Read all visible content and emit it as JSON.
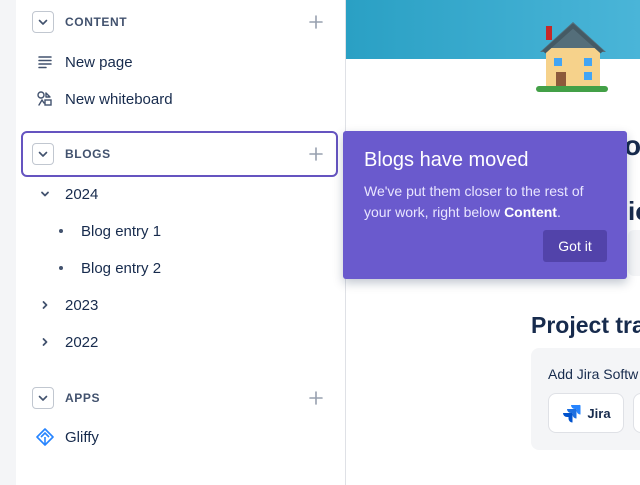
{
  "sidebar": {
    "content_section": {
      "title": "CONTENT",
      "items": [
        {
          "label": "New page",
          "icon": "page-lines-icon"
        },
        {
          "label": "New whiteboard",
          "icon": "whiteboard-shapes-icon"
        }
      ]
    },
    "blogs_section": {
      "title": "BLOGS",
      "years": [
        {
          "label": "2024",
          "expanded": true,
          "entries": [
            "Blog entry 1",
            "Blog entry 2"
          ]
        },
        {
          "label": "2023",
          "expanded": false
        },
        {
          "label": "2022",
          "expanded": false
        }
      ]
    },
    "apps_section": {
      "title": "APPS",
      "items": [
        {
          "label": "Gliffy",
          "icon": "gliffy-icon"
        }
      ]
    }
  },
  "spotlight": {
    "title": "Blogs have moved",
    "body_prefix": "We've put them closer to the rest of your work, right below ",
    "body_bold": "Content",
    "body_suffix": ".",
    "button_label": "Got it"
  },
  "main": {
    "heading_fragment_1": "or",
    "heading_fragment_2": "io",
    "project_title": "Project tra",
    "jira_card": {
      "title": "Add Jira Softw",
      "button_label": "Jira"
    }
  },
  "colors": {
    "spotlight_bg": "#6a5acd",
    "spotlight_button": "#5243aa",
    "highlight_border": "#6554c0",
    "banner": "#2aa0c4",
    "jira_blue": "#2684ff"
  }
}
